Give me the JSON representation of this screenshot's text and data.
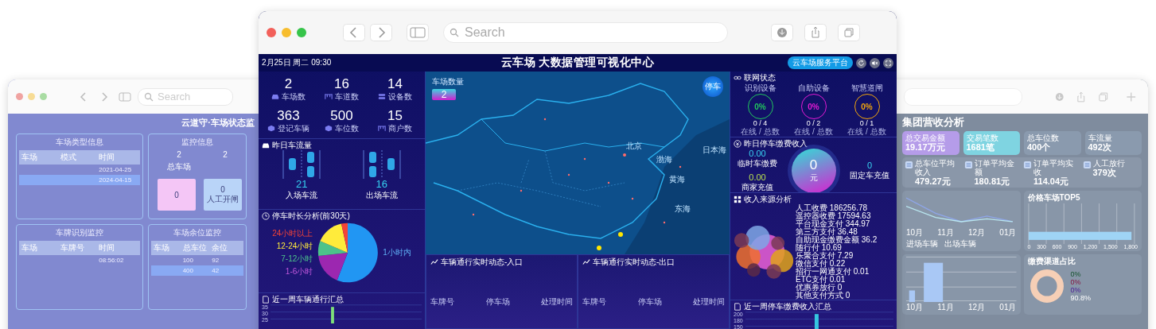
{
  "back_left_window": {
    "search": {
      "placeholder": "Search"
    },
    "title": "云道守·车场状态监",
    "parking_types": {
      "title": "车场类型信息",
      "columns": [
        "车场",
        "模式",
        "时间"
      ],
      "rows": [
        {
          "time": "2021-04-25",
          "selected": false
        },
        {
          "time": "2024-04-15",
          "selected": true
        }
      ]
    },
    "monitor": {
      "title": "监控信息",
      "stats": [
        {
          "value": "2",
          "label": "总车场"
        },
        {
          "value": "2"
        }
      ],
      "cards": [
        {
          "value": "0",
          "color": "#f4c6f6"
        },
        {
          "value": "0",
          "label": "人工开闸",
          "color": "#b9d4f8"
        }
      ]
    },
    "plate_monitor": {
      "title": "车牌识别监控",
      "columns": [
        "车场",
        "车牌号",
        "时间"
      ],
      "rows": [
        {
          "time": "08:56:02"
        }
      ]
    },
    "space_monitor": {
      "title": "车场余位监控",
      "columns": [
        "车场",
        "总车位",
        "余位"
      ],
      "rows": [
        {
          "total": "100",
          "free": "92",
          "selected": false
        },
        {
          "total": "400",
          "free": "42",
          "selected": true
        }
      ]
    }
  },
  "window": {
    "search": {
      "placeholder": "Search"
    }
  },
  "header": {
    "datetime": "2月25日 周二 09:30",
    "title": "云车场 大数据管理可视化中心",
    "platform_button": "云车场服务平台"
  },
  "stats": [
    {
      "value": "2",
      "label": "车场数"
    },
    {
      "value": "16",
      "label": "车道数"
    },
    {
      "value": "14",
      "label": "设备数"
    },
    {
      "value": "363",
      "label": "登记车辆"
    },
    {
      "value": "500",
      "label": "车位数"
    },
    {
      "value": "15",
      "label": "商户数"
    }
  ],
  "traffic": {
    "title": "昨日车流量",
    "entries": [
      {
        "value": "21",
        "label": "入场车流"
      },
      {
        "value": "16",
        "label": "出场车流"
      }
    ]
  },
  "duration": {
    "title": "停车时长分析(前30天)",
    "labels": [
      "24小时以上",
      "12-24小时",
      "7-12小时",
      "1-6小时",
      "1小时内"
    ]
  },
  "weekly_traffic": {
    "title": "近一周车辆通行汇总",
    "yticks": [
      "35",
      "30",
      "25"
    ]
  },
  "map": {
    "count_label": "车场数量",
    "count": "2",
    "toggle": "停车",
    "places": [
      {
        "name": "北京"
      },
      {
        "name": "渤海"
      },
      {
        "name": "黄海"
      },
      {
        "name": "东海"
      },
      {
        "name": "日本海"
      }
    ]
  },
  "feeds": [
    {
      "title": "车辆通行实时动态-入口",
      "columns": [
        "车牌号",
        "停车场",
        "处理时间"
      ]
    },
    {
      "title": "车辆通行实时动态-出口",
      "columns": [
        "车牌号",
        "停车场",
        "处理时间"
      ]
    }
  ],
  "network": {
    "title": "联网状态",
    "devices": [
      {
        "name": "识别设备",
        "percent": "0%",
        "count": "0 / 4",
        "caption": "在线 / 总数",
        "color": "#22c55e"
      },
      {
        "name": "自助设备",
        "percent": "0%",
        "count": "0 / 2",
        "caption": "在线 / 总数",
        "color": "#e21bd2"
      },
      {
        "name": "智慧道闸",
        "percent": "0%",
        "count": "0 / 1",
        "caption": "在线 / 总数",
        "color": "#f2a60c"
      }
    ]
  },
  "income": {
    "title": "昨日停车缴费收入",
    "total": "0",
    "unit": "元",
    "items": [
      {
        "value": "0.00",
        "label": "临时车缴费"
      },
      {
        "value": "0.00",
        "label": "商家充值"
      },
      {
        "value": "0",
        "label": "固定车充值"
      }
    ]
  },
  "sources": {
    "title": "收入来源分析",
    "items": [
      {
        "name": "人工收费",
        "value": "186256.78"
      },
      {
        "name": "遥控器收费",
        "value": "17594.63"
      },
      {
        "name": "平台现金支付",
        "value": "344.97"
      },
      {
        "name": "第三方支付",
        "value": "36.48"
      },
      {
        "name": "自助现金缴费金额",
        "value": "36.2"
      },
      {
        "name": "随行付",
        "value": "10.69"
      },
      {
        "name": "乐聚合支付",
        "value": "7.29"
      },
      {
        "name": "微信支付",
        "value": "0.22"
      },
      {
        "name": "招行一网通支付",
        "value": "0.01"
      },
      {
        "name": "ETC支付",
        "value": "0.01"
      },
      {
        "name": "优惠券放行",
        "value": "0"
      },
      {
        "name": "其他支付方式",
        "value": "0"
      }
    ]
  },
  "weekly_income": {
    "title": "近一周停车缴费收入汇总",
    "yticks": [
      "200",
      "180",
      "150"
    ]
  },
  "back_right_window": {
    "title": "集团营收分析",
    "cards": [
      {
        "label": "总交易金额",
        "value": "19.17万元",
        "color": "#b59ce9"
      },
      {
        "label": "交易笔数",
        "value": "1681笔",
        "color": "#7fd4e1"
      },
      {
        "label": "总车位数",
        "value": "400个",
        "color": "#8a9aae"
      },
      {
        "label": "车流量",
        "value": "492次",
        "color": "#8a9aae"
      }
    ],
    "averages": [
      {
        "label": "总车位平均收入",
        "value": "479.27元"
      },
      {
        "label": "订单平均金额",
        "value": "180.81元"
      },
      {
        "label": "订单平均实收",
        "value": "114.04元"
      },
      {
        "label": "人工放行",
        "value": "379次"
      }
    ],
    "trend": {
      "months": [
        "10月",
        "11月",
        "12月",
        "01月"
      ],
      "legend": [
        "进场车辆",
        "出场车辆"
      ]
    },
    "top5": {
      "title": "价格车场TOP5",
      "xticks": [
        "0",
        "300",
        "600",
        "900",
        "1,200",
        "1,500",
        "1,800"
      ]
    },
    "channels": {
      "title": "缴费渠道占比",
      "labels": [
        "0%",
        "0%",
        "0%",
        "90.8%"
      ]
    },
    "monthly": {
      "months": [
        "10月",
        "11月",
        "12月",
        "01月"
      ]
    }
  }
}
